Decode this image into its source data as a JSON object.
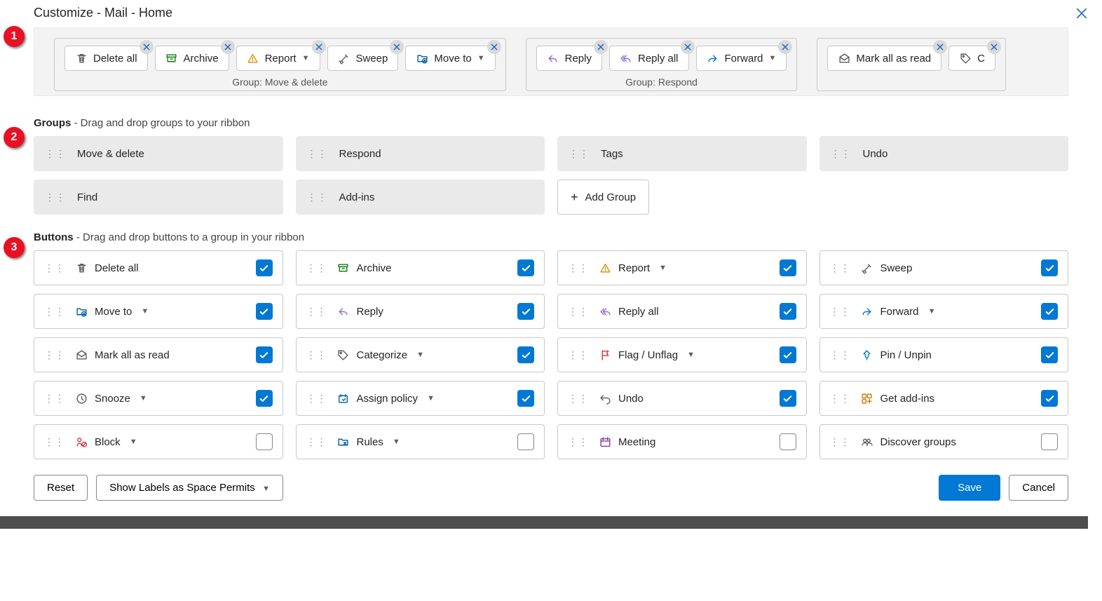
{
  "title": "Customize - Mail - Home",
  "steps": [
    "1",
    "2",
    "3"
  ],
  "ribbon": {
    "groups": [
      {
        "label": "Group: Move & delete",
        "buttons": [
          {
            "icon": "trash",
            "label": "Delete all",
            "dropdown": false,
            "color": "#5b5b5b"
          },
          {
            "icon": "archive",
            "label": "Archive",
            "dropdown": false,
            "color": "#107c10"
          },
          {
            "icon": "warning",
            "label": "Report",
            "dropdown": true,
            "color": "#d29200"
          },
          {
            "icon": "sweep",
            "label": "Sweep",
            "dropdown": false,
            "color": "#5b5b5b"
          },
          {
            "icon": "folder-move",
            "label": "Move to",
            "dropdown": true,
            "color": "#005ea6"
          }
        ]
      },
      {
        "label": "Group: Respond",
        "buttons": [
          {
            "icon": "reply",
            "label": "Reply",
            "dropdown": false,
            "color": "#8e6fd4"
          },
          {
            "icon": "reply-all",
            "label": "Reply all",
            "dropdown": false,
            "color": "#8e6fd4"
          },
          {
            "icon": "forward",
            "label": "Forward",
            "dropdown": true,
            "color": "#0078d4"
          }
        ]
      },
      {
        "label": "",
        "buttons": [
          {
            "icon": "mail-read",
            "label": "Mark all as read",
            "dropdown": false,
            "color": "#5b5b5b"
          },
          {
            "icon": "tag",
            "label": "C",
            "dropdown": false,
            "color": "#5b5b5b",
            "partial": true
          }
        ]
      }
    ]
  },
  "groups_section": {
    "title": "Groups",
    "help": "- Drag and drop groups to your ribbon",
    "tiles": [
      "Move & delete",
      "Respond",
      "Tags",
      "Undo",
      "Find",
      "Add-ins"
    ],
    "add_label": "Add Group"
  },
  "buttons_section": {
    "title": "Buttons",
    "help": "- Drag and drop buttons to a group in your ribbon",
    "items": [
      {
        "icon": "trash",
        "label": "Delete all",
        "dropdown": false,
        "checked": true,
        "color": "#5b5b5b"
      },
      {
        "icon": "archive",
        "label": "Archive",
        "dropdown": false,
        "checked": true,
        "color": "#107c10"
      },
      {
        "icon": "warning",
        "label": "Report",
        "dropdown": true,
        "checked": true,
        "color": "#d29200"
      },
      {
        "icon": "sweep",
        "label": "Sweep",
        "dropdown": false,
        "checked": true,
        "color": "#5b5b5b"
      },
      {
        "icon": "folder-move",
        "label": "Move to",
        "dropdown": true,
        "checked": true,
        "color": "#005ea6"
      },
      {
        "icon": "reply",
        "label": "Reply",
        "dropdown": false,
        "checked": true,
        "color": "#8e6fd4"
      },
      {
        "icon": "reply-all",
        "label": "Reply all",
        "dropdown": false,
        "checked": true,
        "color": "#8e6fd4"
      },
      {
        "icon": "forward",
        "label": "Forward",
        "dropdown": true,
        "checked": true,
        "color": "#0078d4"
      },
      {
        "icon": "mail-read",
        "label": "Mark all as read",
        "dropdown": false,
        "checked": true,
        "color": "#5b5b5b"
      },
      {
        "icon": "tag",
        "label": "Categorize",
        "dropdown": true,
        "checked": true,
        "color": "#5b5b5b"
      },
      {
        "icon": "flag",
        "label": "Flag / Unflag",
        "dropdown": true,
        "checked": true,
        "color": "#d13438"
      },
      {
        "icon": "pin",
        "label": "Pin / Unpin",
        "dropdown": false,
        "checked": true,
        "color": "#0078d4"
      },
      {
        "icon": "clock",
        "label": "Snooze",
        "dropdown": true,
        "checked": true,
        "color": "#5b5b5b"
      },
      {
        "icon": "policy",
        "label": "Assign policy",
        "dropdown": true,
        "checked": true,
        "color": "#005ea6"
      },
      {
        "icon": "undo",
        "label": "Undo",
        "dropdown": false,
        "checked": true,
        "color": "#5b5b5b"
      },
      {
        "icon": "addins",
        "label": "Get add-ins",
        "dropdown": false,
        "checked": true,
        "color": "#d47300"
      },
      {
        "icon": "block",
        "label": "Block",
        "dropdown": true,
        "checked": false,
        "color": "#d13438"
      },
      {
        "icon": "rules",
        "label": "Rules",
        "dropdown": true,
        "checked": false,
        "color": "#005ea6"
      },
      {
        "icon": "meeting",
        "label": "Meeting",
        "dropdown": false,
        "checked": false,
        "color": "#8a3a9c"
      },
      {
        "icon": "discover",
        "label": "Discover groups",
        "dropdown": false,
        "checked": false,
        "color": "#5b5b5b"
      }
    ]
  },
  "footer": {
    "reset": "Reset",
    "show_labels": "Show Labels as Space Permits",
    "save": "Save",
    "cancel": "Cancel"
  }
}
